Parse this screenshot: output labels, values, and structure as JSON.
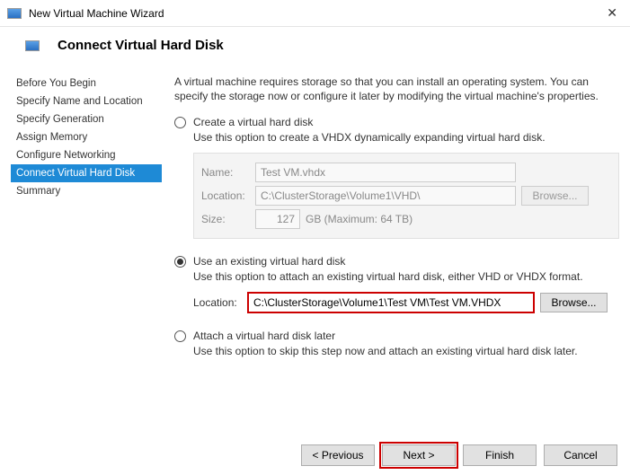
{
  "window": {
    "title": "New Virtual Machine Wizard",
    "close": "✕"
  },
  "page_heading": "Connect Virtual Hard Disk",
  "sidebar": {
    "steps": [
      {
        "label": "Before You Begin"
      },
      {
        "label": "Specify Name and Location"
      },
      {
        "label": "Specify Generation"
      },
      {
        "label": "Assign Memory"
      },
      {
        "label": "Configure Networking"
      },
      {
        "label": "Connect Virtual Hard Disk"
      },
      {
        "label": "Summary"
      }
    ],
    "active_index": 5
  },
  "intro": "A virtual machine requires storage so that you can install an operating system. You can specify the storage now or configure it later by modifying the virtual machine's properties.",
  "options": {
    "create": {
      "label": "Create a virtual hard disk",
      "desc": "Use this option to create a VHDX dynamically expanding virtual hard disk.",
      "name_label": "Name:",
      "name_value": "Test VM.vhdx",
      "loc_label": "Location:",
      "loc_value": "C:\\ClusterStorage\\Volume1\\VHD\\",
      "browse_label": "Browse...",
      "size_label": "Size:",
      "size_value": "127",
      "size_unit": "GB (Maximum: 64 TB)"
    },
    "existing": {
      "label": "Use an existing virtual hard disk",
      "desc": "Use this option to attach an existing virtual hard disk, either VHD or VHDX format.",
      "loc_label": "Location:",
      "loc_value": "C:\\ClusterStorage\\Volume1\\Test VM\\Test VM.VHDX",
      "browse_label": "Browse..."
    },
    "later": {
      "label": "Attach a virtual hard disk later",
      "desc": "Use this option to skip this step now and attach an existing virtual hard disk later."
    },
    "selected": "existing"
  },
  "footer": {
    "previous": "< Previous",
    "next": "Next >",
    "finish": "Finish",
    "cancel": "Cancel"
  }
}
